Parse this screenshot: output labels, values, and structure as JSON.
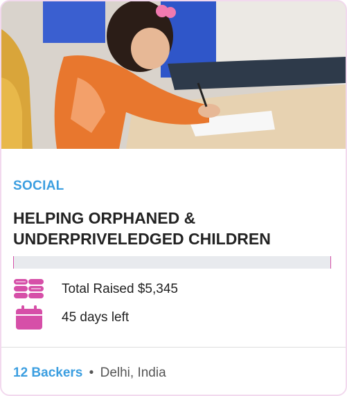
{
  "campaign": {
    "category": "SOCIAL",
    "title": "HELPING ORPHANED & UNDERPRIVELEDGED CHILDREN",
    "progress_percent": 0,
    "raised_text": "Total Raised $5,345",
    "days_left_text": "45 days left",
    "backers_text": "12 Backers",
    "separator": "•",
    "location": "Delhi, India"
  },
  "icons": {
    "raised": "coins-stack-icon",
    "days_left": "calendar-icon"
  },
  "colors": {
    "accent_blue": "#3b9ee0",
    "accent_pink": "#d64fa8",
    "text": "#222222"
  }
}
